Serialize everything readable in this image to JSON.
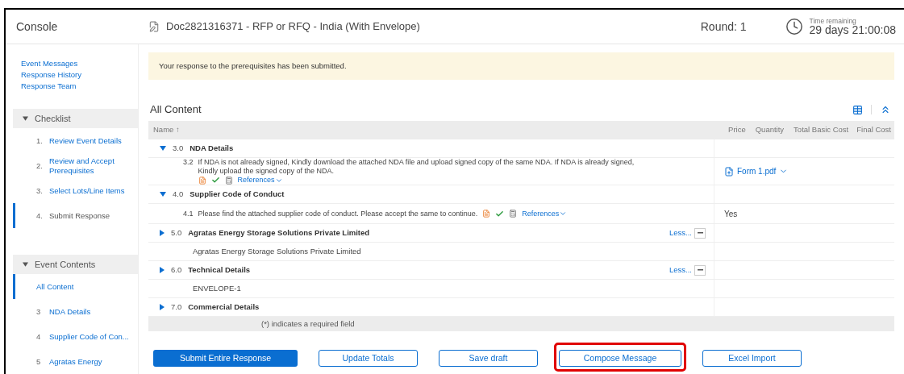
{
  "sidebar": {
    "title": "Console",
    "links": [
      "Event Messages",
      "Response History",
      "Response Team"
    ],
    "checklist": {
      "title": "Checklist",
      "expanded": true,
      "items": [
        {
          "number": "1.",
          "label": "Review Event Details",
          "selected": false
        },
        {
          "number": "2.",
          "label": "Review and Accept Prerequisites",
          "selected": false
        },
        {
          "number": "3.",
          "label": "Select Lots/Line Items",
          "selected": false
        },
        {
          "number": "4.",
          "label": "Submit Response",
          "selected": true
        }
      ]
    },
    "event_contents": {
      "title": "Event Contents",
      "expanded": true,
      "items": [
        {
          "label": "All Content",
          "selected": true
        },
        {
          "number": "3",
          "label": "NDA Details",
          "selected": false
        },
        {
          "number": "4",
          "label": "Supplier Code of Con...",
          "selected": false
        },
        {
          "number": "5",
          "label": "Agratas Energy",
          "selected": false
        }
      ]
    }
  },
  "header": {
    "title": "Doc2821316371 - RFP or RFQ - India (With Envelope)",
    "round": "Round: 1",
    "time_label": "Time remaining",
    "time_value": "29 days 21:00:08"
  },
  "banner": "Your response to the prerequisites has been submitted.",
  "content": {
    "title": "All Content",
    "columns": {
      "name": "Name",
      "sort_mark": "↑",
      "price": "Price",
      "quantity": "Quantity",
      "total": "Total Basic Cost",
      "final": "Final Cost"
    },
    "rows": [
      {
        "kind": "section",
        "number": "3.0",
        "title": "NDA Details",
        "expanded": true
      },
      {
        "kind": "question",
        "number": "3.2",
        "text": "If NDA is not already signed, Kindly download the attached NDA file and upload signed copy of the same NDA. If NDA is already signed, Kindly upload the signed copy of the NDA.",
        "references": "References",
        "response": {
          "kind": "file",
          "label": "Form 1.pdf"
        }
      },
      {
        "kind": "section",
        "number": "4.0",
        "title": "Supplier Code of Conduct",
        "expanded": true
      },
      {
        "kind": "question",
        "number": "4.1",
        "text": "Please find the attached supplier code of conduct. Please accept the same to continue.",
        "references": "References",
        "response": {
          "kind": "text",
          "label": "Yes"
        }
      },
      {
        "kind": "section",
        "number": "5.0",
        "title": "Agratas Energy Storage Solutions Private Limited",
        "expanded": false,
        "less": "Less..."
      },
      {
        "kind": "text",
        "text": "Agratas Energy Storage Solutions Private Limited"
      },
      {
        "kind": "section",
        "number": "6.0",
        "title": "Technical Details",
        "expanded": false,
        "less": "Less..."
      },
      {
        "kind": "text",
        "text": "ENVELOPE-1"
      },
      {
        "kind": "section",
        "number": "7.0",
        "title": "Commercial Details",
        "expanded": false
      }
    ],
    "footnote": "(*) indicates a required field"
  },
  "buttons": [
    {
      "label": "Submit Entire Response",
      "primary": true,
      "highlighted": false
    },
    {
      "label": "Update Totals",
      "primary": false,
      "highlighted": false
    },
    {
      "label": "Save draft",
      "primary": false,
      "highlighted": false
    },
    {
      "label": "Compose Message",
      "primary": false,
      "highlighted": true
    },
    {
      "label": "Excel Import",
      "primary": false,
      "highlighted": false
    }
  ]
}
